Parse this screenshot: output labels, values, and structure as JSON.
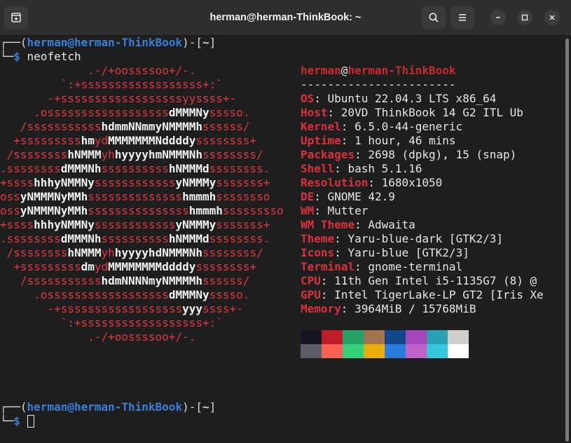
{
  "window": {
    "title": "herman@herman-ThinkBook: ~"
  },
  "prompt1": {
    "corner_top": "┌──(",
    "user_host": "herman@herman-ThinkBook",
    "mid": ")-[",
    "dir": "~",
    "end": "]",
    "corner_bottom": "└─",
    "dollar": "$",
    "command": " neofetch"
  },
  "logo_lines": [
    [
      [
        "r",
        "             .-/+oossssoo+/-."
      ]
    ],
    [
      [
        "r",
        "         `:+ssssssssssssssssss+:`"
      ]
    ],
    [
      [
        "r",
        "       -+ssssssssssssssssssyyssss+-"
      ]
    ],
    [
      [
        "r",
        "     .ossssssssssssssssss"
      ],
      [
        "w",
        "dMMMNy"
      ],
      [
        "r",
        "sssso."
      ]
    ],
    [
      [
        "r",
        "   /sssssssssss"
      ],
      [
        "w",
        "hdmmNNmmyNMMMMh"
      ],
      [
        "r",
        "ssssss/"
      ]
    ],
    [
      [
        "r",
        "  +sssssssss"
      ],
      [
        "w",
        "hm"
      ],
      [
        "r",
        "yd"
      ],
      [
        "w",
        "MMMMMMMNddddy"
      ],
      [
        "r",
        "ssssssss+"
      ]
    ],
    [
      [
        "r",
        " /ssssssss"
      ],
      [
        "w",
        "hNMMM"
      ],
      [
        "r",
        "yh"
      ],
      [
        "w",
        "hyyyyhmNMMMNh"
      ],
      [
        "r",
        "ssssssss/"
      ]
    ],
    [
      [
        "r",
        ".ssssssss"
      ],
      [
        "w",
        "dMMMNh"
      ],
      [
        "r",
        "ssssssssss"
      ],
      [
        "w",
        "hNMMMd"
      ],
      [
        "r",
        "ssssssss."
      ]
    ],
    [
      [
        "r",
        "+ssss"
      ],
      [
        "w",
        "hhhyNMMNy"
      ],
      [
        "r",
        "ssssssssssss"
      ],
      [
        "w",
        "yNMMMy"
      ],
      [
        "r",
        "sssssss+"
      ]
    ],
    [
      [
        "r",
        "oss"
      ],
      [
        "w",
        "yNMMMNyMMh"
      ],
      [
        "r",
        "ssssssssssssss"
      ],
      [
        "w",
        "hmmmh"
      ],
      [
        "r",
        "ssssssso"
      ]
    ],
    [
      [
        "r",
        "oss"
      ],
      [
        "w",
        "yNMMMNyMMh"
      ],
      [
        "r",
        "sssssssssssssss"
      ],
      [
        "w",
        "hmmmh"
      ],
      [
        "r",
        "sssssssso"
      ]
    ],
    [
      [
        "r",
        "+ssss"
      ],
      [
        "w",
        "hhhyNMMNy"
      ],
      [
        "r",
        "ssssssssssss"
      ],
      [
        "w",
        "yNMMMy"
      ],
      [
        "r",
        "sssssss+"
      ]
    ],
    [
      [
        "r",
        ".ssssssss"
      ],
      [
        "w",
        "dMMMNh"
      ],
      [
        "r",
        "ssssssssss"
      ],
      [
        "w",
        "hNMMMd"
      ],
      [
        "r",
        "ssssssss."
      ]
    ],
    [
      [
        "r",
        " /ssssssss"
      ],
      [
        "w",
        "hNMMM"
      ],
      [
        "r",
        "yh"
      ],
      [
        "w",
        "hyyyyhdNMMMNh"
      ],
      [
        "r",
        "ssssssss/"
      ]
    ],
    [
      [
        "r",
        "  +sssssssss"
      ],
      [
        "w",
        "dm"
      ],
      [
        "r",
        "yd"
      ],
      [
        "w",
        "MMMMMMMMddddy"
      ],
      [
        "r",
        "ssssssss+"
      ]
    ],
    [
      [
        "r",
        "   /sssssssssss"
      ],
      [
        "w",
        "hdmNNNNmyNMMMMh"
      ],
      [
        "r",
        "ssssss/"
      ]
    ],
    [
      [
        "r",
        "     .ossssssssssssssssss"
      ],
      [
        "w",
        "dMMMNy"
      ],
      [
        "r",
        "sssso."
      ]
    ],
    [
      [
        "r",
        "       -+ssssssssssssssssss"
      ],
      [
        "w",
        "yyy"
      ],
      [
        "r",
        "ssss+-"
      ]
    ],
    [
      [
        "r",
        "         `:+ssssssssssssssssss+:`"
      ]
    ],
    [
      [
        "r",
        "             .-/+oossssoo+/-."
      ]
    ]
  ],
  "info": {
    "user": "herman",
    "at": "@",
    "host": "herman-ThinkBook",
    "separator": "-----------------------",
    "rows": [
      {
        "key": "OS",
        "value": ": Ubuntu 22.04.3 LTS x86_64"
      },
      {
        "key": "Host",
        "value": ": 20VD ThinkBook 14 G2 ITL Ub"
      },
      {
        "key": "Kernel",
        "value": ": 6.5.0-44-generic"
      },
      {
        "key": "Uptime",
        "value": ": 1 hour, 46 mins"
      },
      {
        "key": "Packages",
        "value": ": 2698 (dpkg), 15 (snap)"
      },
      {
        "key": "Shell",
        "value": ": bash 5.1.16"
      },
      {
        "key": "Resolution",
        "value": ": 1680x1050"
      },
      {
        "key": "DE",
        "value": ": GNOME 42.9"
      },
      {
        "key": "WM",
        "value": ": Mutter"
      },
      {
        "key": "WM Theme",
        "value": ": Adwaita"
      },
      {
        "key": "Theme",
        "value": ": Yaru-blue-dark [GTK2/3]"
      },
      {
        "key": "Icons",
        "value": ": Yaru-blue [GTK2/3]"
      },
      {
        "key": "Terminal",
        "value": ": gnome-terminal"
      },
      {
        "key": "CPU",
        "value": ": 11th Gen Intel i5-1135G7 (8) @"
      },
      {
        "key": "GPU",
        "value": ": Intel TigerLake-LP GT2 [Iris Xe"
      },
      {
        "key": "Memory",
        "value": ": 3964MiB / 15768MiB"
      }
    ]
  },
  "palette": {
    "row1": [
      "#171421",
      "#c01c28",
      "#26a269",
      "#a2734c",
      "#12488b",
      "#a347ba",
      "#2aa1b3",
      "#d0cfcc"
    ],
    "row2": [
      "#5e5c64",
      "#f66151",
      "#33d17a",
      "#e9ad0c",
      "#2a7bde",
      "#c061cb",
      "#33c7de",
      "#ffffff"
    ]
  },
  "prompt2": {
    "corner_top": "┌──(",
    "user_host": "herman@herman-ThinkBook",
    "mid": ")-[",
    "dir": "~",
    "end": "]",
    "corner_bottom": "└─",
    "dollar": "$"
  }
}
